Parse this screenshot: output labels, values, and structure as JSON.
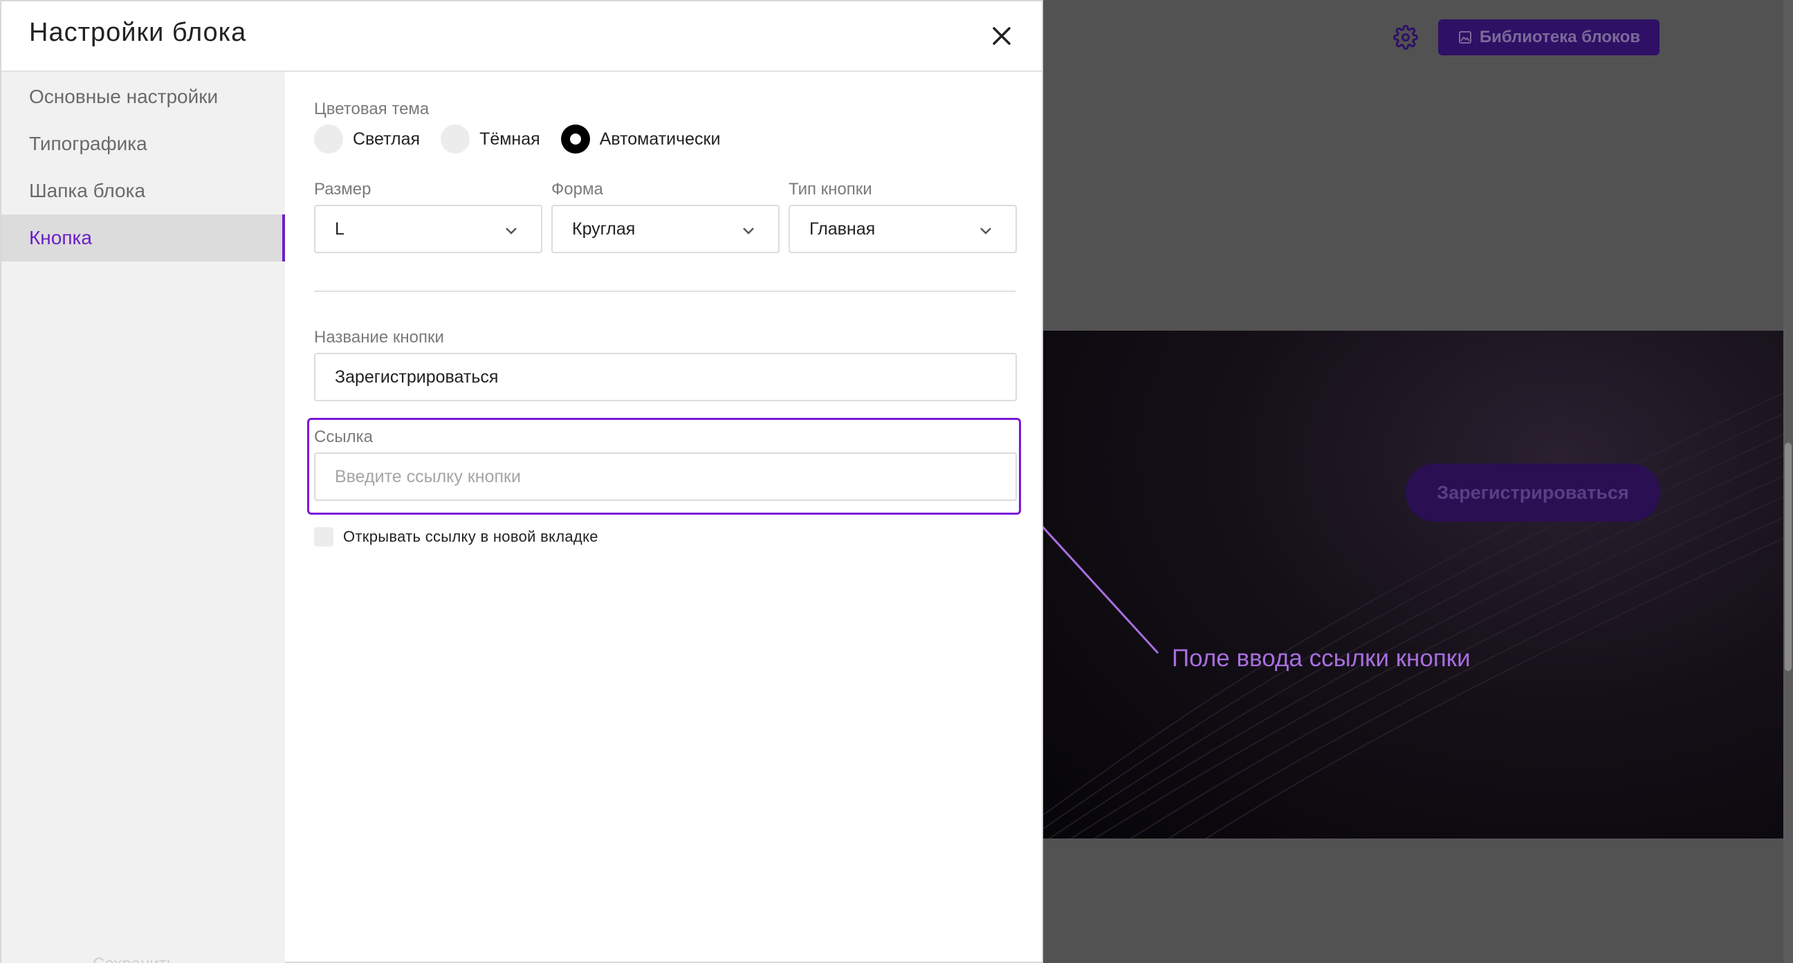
{
  "modal": {
    "title": "Настройки блока",
    "close_icon": "close-icon"
  },
  "sidebar": {
    "items": [
      {
        "label": "Основные настройки",
        "active": false
      },
      {
        "label": "Типографика",
        "active": false
      },
      {
        "label": "Шапка блока",
        "active": false
      },
      {
        "label": "Кнопка",
        "active": true
      }
    ],
    "footer_partial": "Сохранить"
  },
  "form": {
    "color_theme": {
      "label": "Цветовая тема",
      "options": [
        "Светлая",
        "Тёмная",
        "Автоматически"
      ],
      "selected": "Автоматически"
    },
    "size": {
      "label": "Размер",
      "value": "L"
    },
    "shape": {
      "label": "Форма",
      "value": "Круглая"
    },
    "button_type": {
      "label": "Тип кнопки",
      "value": "Главная"
    },
    "button_name": {
      "label": "Название кнопки",
      "value": "Зарегистрироваться"
    },
    "link": {
      "label": "Ссылка",
      "value": "",
      "placeholder": "Введите ссылку кнопки"
    },
    "open_new_tab": {
      "label": "Открывать ссылку в новой вкладке",
      "checked": false
    }
  },
  "editor": {
    "library_button": "Библиотека блоков",
    "preview_cta": "Зарегистрироваться",
    "icons": {
      "settings": "gear-icon",
      "library": "image-icon"
    }
  },
  "annotation": {
    "text": "Поле ввода ссылки кнопки",
    "color": "#a86ee0"
  },
  "colors": {
    "accent": "#6b1fc7",
    "highlight_border": "#7a18d8",
    "library_button_bg": "#2e1065",
    "backdrop": "#525252"
  }
}
